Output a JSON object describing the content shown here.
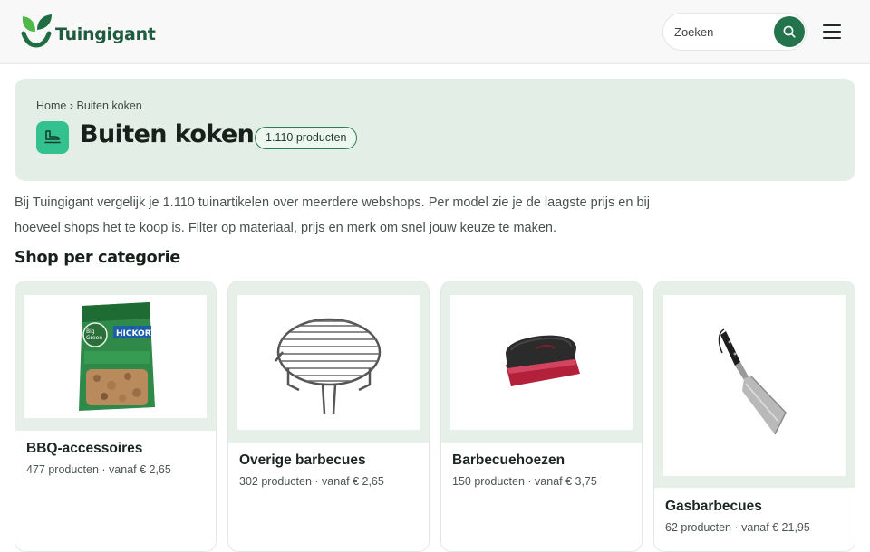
{
  "brand": {
    "name": "Tuingigant",
    "accent": "#23744c",
    "leaf_dark": "#1f6d42",
    "leaf_light": "#4fb849"
  },
  "header": {
    "search_placeholder": "Zoeken",
    "search_icon": "search-icon",
    "menu_icon": "hamburger-menu-icon"
  },
  "breadcrumb": {
    "home": "Home",
    "separator": "›",
    "current": "Buiten koken"
  },
  "page": {
    "icon": "bbq-category-icon",
    "title": "Buiten koken",
    "product_count": "1.110 producten",
    "intro": "Bij Tuingigant vergelijk je 1.110 tuinartikelen over meerdere webshops. Per model zie je de laagste prijs en bij hoeveel shops het te koop is. Filter op materiaal, prijs en merk om snel jouw keuze te maken."
  },
  "categories": {
    "title": "Shop per categorie",
    "items": [
      {
        "name": "BBQ-accessoires",
        "meta": "477 producten · vanaf € 2,65",
        "image": "hickory-smoking-chips-bag"
      },
      {
        "name": "Overige barbecues",
        "meta": "302 producten · vanaf € 2,65",
        "image": "round-grill-grate"
      },
      {
        "name": "Barbecuehoezen",
        "meta": "150 producten · vanaf € 3,75",
        "image": "grill-cleaning-sponge"
      },
      {
        "name": "Gasbarbecues",
        "meta": "62 producten · vanaf € 21,95",
        "image": "bbq-spatula"
      }
    ]
  }
}
